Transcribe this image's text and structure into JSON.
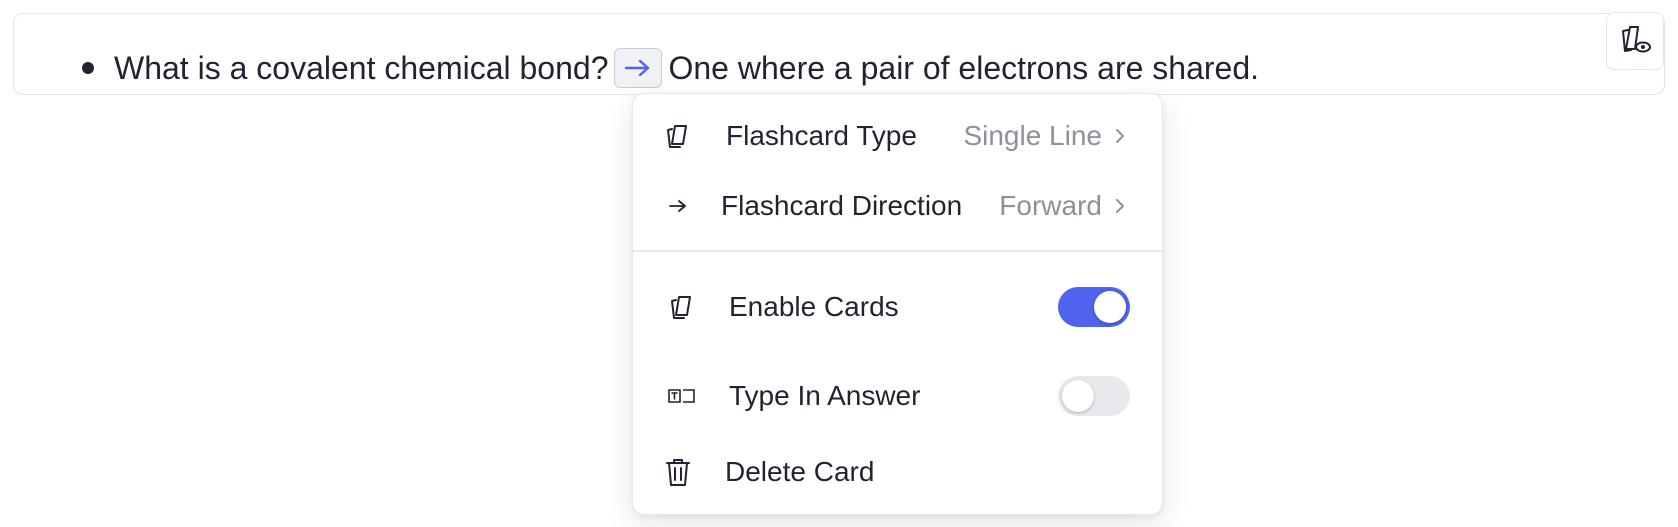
{
  "line": {
    "question": "What is a covalent chemical bond?",
    "answer": "One where a pair of electrons are shared.",
    "separator_icon": "arrow-right-icon",
    "corner_icon": "card-preview-icon"
  },
  "menu": {
    "flashcard_type": {
      "icon": "cards-icon",
      "label": "Flashcard Type",
      "value": "Single Line"
    },
    "flashcard_direction": {
      "icon": "arrow-right-icon",
      "label": "Flashcard Direction",
      "value": "Forward"
    },
    "enable_cards": {
      "icon": "cards-icon",
      "label": "Enable Cards",
      "enabled": true
    },
    "type_in_answer": {
      "icon": "text-input-icon",
      "label": "Type In Answer",
      "enabled": false
    },
    "delete_card": {
      "icon": "trash-icon",
      "label": "Delete Card"
    }
  },
  "colors": {
    "accent": "#4f63ee",
    "text": "#1f2430",
    "muted": "#8e919b",
    "border": "#e3e5ea"
  }
}
